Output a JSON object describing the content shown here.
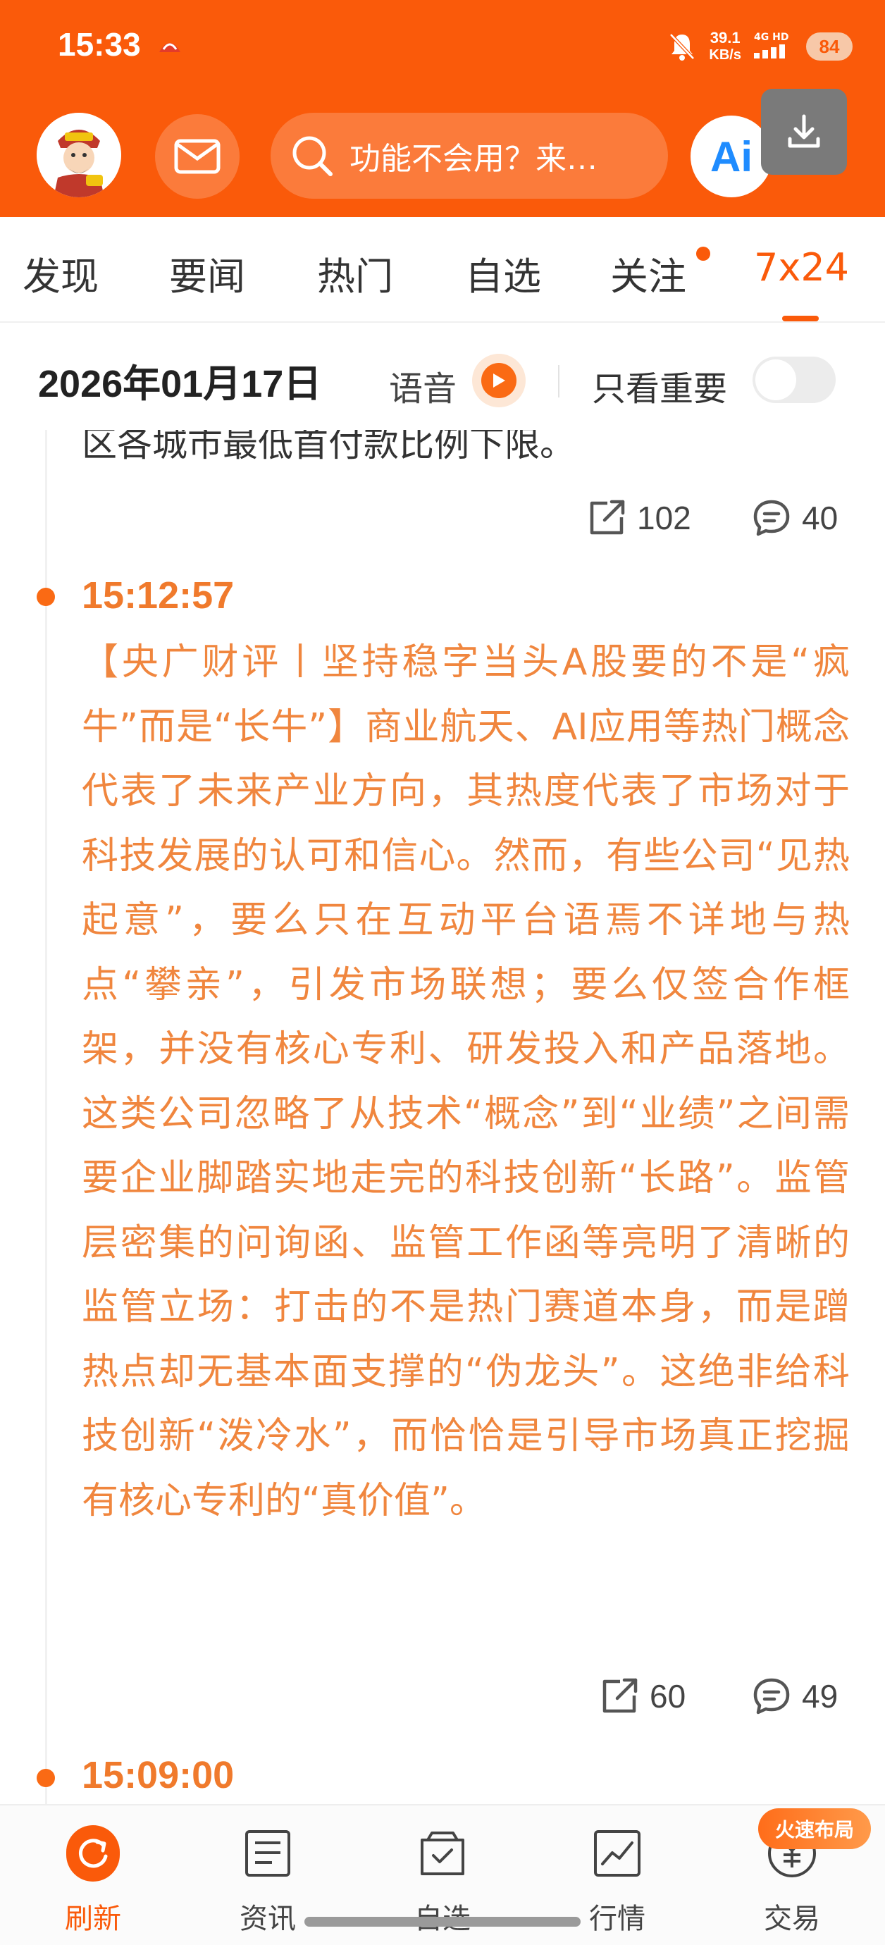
{
  "status_bar": {
    "time": "15:33",
    "speed_value": "39.1",
    "speed_unit": "KB/s",
    "network": "4G HD",
    "battery": "84"
  },
  "header": {
    "search_placeholder": "功能不会用？来…",
    "ai_label": "Ai"
  },
  "tabs": [
    {
      "label": "发现",
      "active": false
    },
    {
      "label": "要闻",
      "active": false
    },
    {
      "label": "热门",
      "active": false
    },
    {
      "label": "自选",
      "active": false
    },
    {
      "label": "关注",
      "active": false,
      "dot": true
    },
    {
      "label": "7x24",
      "active": true
    }
  ],
  "date_bar": {
    "date": "2026年01月17日",
    "voice_label": "语音",
    "important_label": "只看重要",
    "important_on": false
  },
  "feed": {
    "previous_item": {
      "cut_text": "区各城市最低首付款比例下限。",
      "shares": "102",
      "comments": "40"
    },
    "items": [
      {
        "time": "15:12:57",
        "text": "【央广财评丨坚持稳字当头A股要的不是“疯牛”而是“长牛”】商业航天、AI应用等热门概念代表了未来产业方向，其热度代表了市场对于科技发展的认可和信心。然而，有些公司“见热起意”，要么只在互动平台语焉不详地与热点“攀亲”，引发市场联想；要么仅签合作框架，并没有核心专利、研发投入和产品落地。这类公司忽略了从技术“概念”到“业绩”之间需要企业脚踏实地走完的科技创新“长路”。监管层密集的问询函、监管工作函等亮明了清晰的监管立场：打击的不是热门赛道本身，而是蹭热点却无基本面支撑的“伪龙头”。这绝非给科技创新“泼冷水”，而恰恰是引导市场真正挖掘有核心专利的“真价值”。",
        "shares": "60",
        "comments": "49"
      },
      {
        "time": "15:09:00"
      }
    ]
  },
  "bottom_nav": [
    {
      "label": "刷新",
      "icon": "refresh-icon",
      "active": true
    },
    {
      "label": "资讯",
      "icon": "news-icon",
      "active": false
    },
    {
      "label": "自选",
      "icon": "watchlist-icon",
      "active": false
    },
    {
      "label": "行情",
      "icon": "market-icon",
      "active": false
    },
    {
      "label": "交易",
      "icon": "trade-icon",
      "active": false
    }
  ],
  "promo_badge": "火速布局",
  "colors": {
    "brand": "#fa5a0a",
    "news_text": "#f0863e"
  }
}
